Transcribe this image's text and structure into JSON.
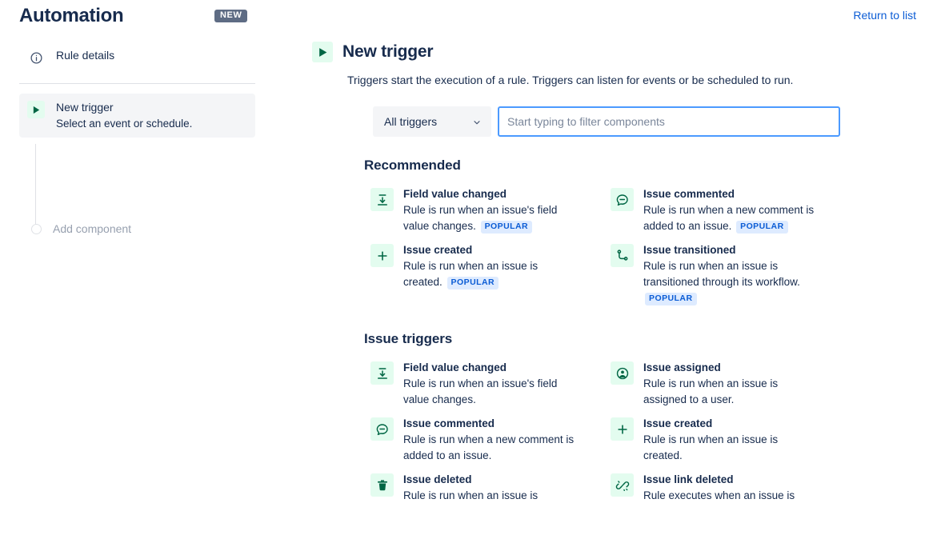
{
  "header": {
    "app_title": "Automation",
    "new_badge": "NEW",
    "return_link": "Return to list"
  },
  "sidebar": {
    "rule_details": {
      "label": "Rule details",
      "icon": "info-icon"
    },
    "new_trigger": {
      "title": "New trigger",
      "subtitle": "Select an event or schedule.",
      "icon": "play-icon"
    },
    "add_component": {
      "label": "Add component",
      "icon": "circle-outline-icon"
    }
  },
  "main": {
    "title": "New trigger",
    "icon": "play-icon",
    "description": "Triggers start the execution of a rule. Triggers can listen for events or be scheduled to run.",
    "filter": {
      "select_value": "All triggers",
      "select_icon": "chevron-down-icon",
      "search_placeholder": "Start typing to filter components",
      "search_value": ""
    },
    "sections": [
      {
        "title": "Recommended",
        "items": [
          {
            "title": "Field value changed",
            "desc": "Rule is run when an issue's field value changes.",
            "badge": "POPULAR",
            "icon": "field-value-changed-icon"
          },
          {
            "title": "Issue commented",
            "desc": "Rule is run when a new comment is added to an issue.",
            "badge": "POPULAR",
            "icon": "comment-icon"
          },
          {
            "title": "Issue created",
            "desc": "Rule is run when an issue is created.",
            "badge": "POPULAR",
            "icon": "plus-icon"
          },
          {
            "title": "Issue transitioned",
            "desc": "Rule is run when an issue is transitioned through its workflow.",
            "badge": "POPULAR",
            "icon": "branch-icon"
          }
        ]
      },
      {
        "title": "Issue triggers",
        "items": [
          {
            "title": "Field value changed",
            "desc": "Rule is run when an issue's field value changes.",
            "badge": "",
            "icon": "field-value-changed-icon"
          },
          {
            "title": "Issue assigned",
            "desc": "Rule is run when an issue is assigned to a user.",
            "badge": "",
            "icon": "person-icon"
          },
          {
            "title": "Issue commented",
            "desc": "Rule is run when a new comment is added to an issue.",
            "badge": "",
            "icon": "comment-icon"
          },
          {
            "title": "Issue created",
            "desc": "Rule is run when an issue is created.",
            "badge": "",
            "icon": "plus-icon"
          },
          {
            "title": "Issue deleted",
            "desc": "Rule is run when an issue is",
            "badge": "",
            "icon": "trash-icon"
          },
          {
            "title": "Issue link deleted",
            "desc": "Rule executes when an issue is",
            "badge": "",
            "icon": "broken-link-icon"
          }
        ]
      }
    ]
  },
  "colors": {
    "accent_green": "#E3FCEF",
    "icon_green": "#006644",
    "link_blue": "#0B5CD5",
    "badge_blue_bg": "#DEEBFF",
    "new_badge_bg": "#5E6C84",
    "focus_border": "#4C9AFF",
    "text": "#172B4D",
    "muted": "#97A0AF"
  }
}
